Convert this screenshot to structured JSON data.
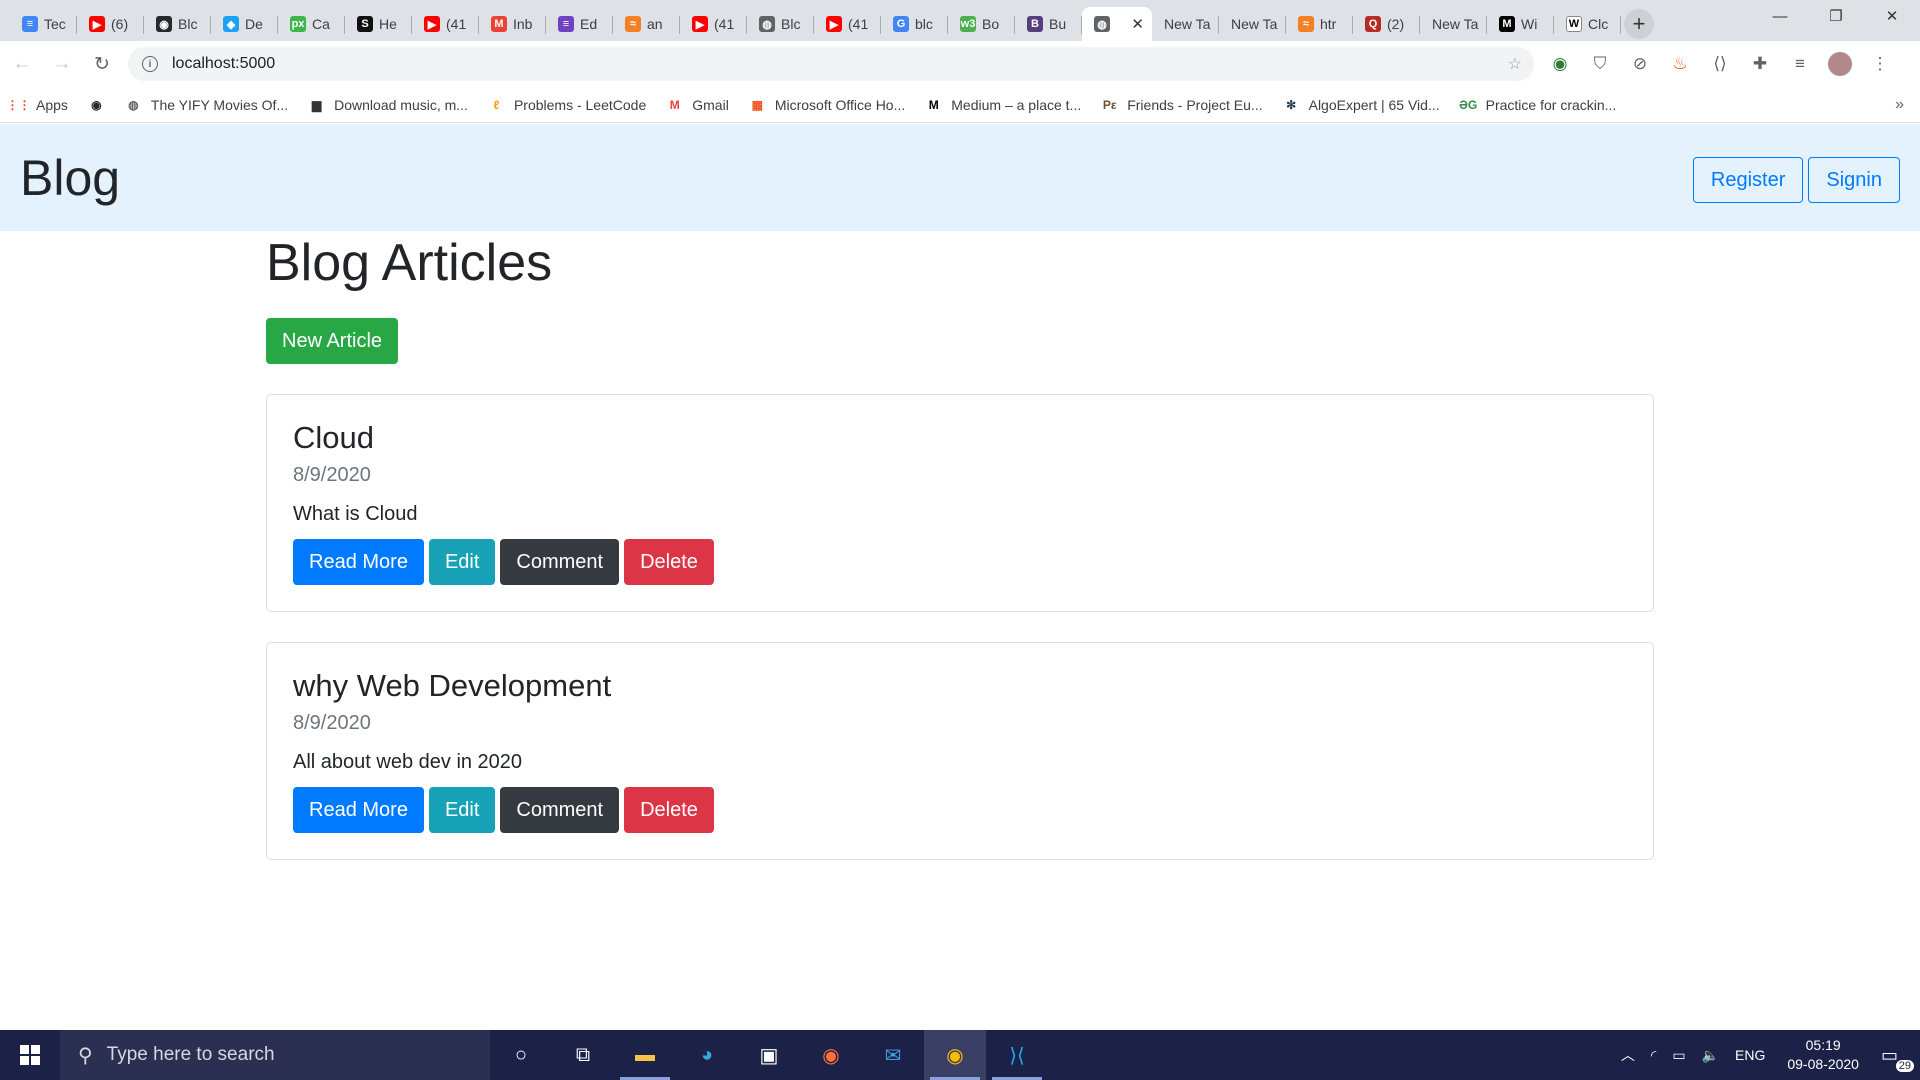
{
  "browser": {
    "tabs": [
      {
        "label": "Tec",
        "icon": "google-docs-icon",
        "color": "#4285f4",
        "glyph": "≡"
      },
      {
        "label": "(6)",
        "icon": "youtube-icon",
        "color": "#ff0000",
        "glyph": "▶"
      },
      {
        "label": "Blc",
        "icon": "github-icon",
        "color": "#24292e",
        "glyph": "◉"
      },
      {
        "label": "De",
        "icon": "bird-icon",
        "color": "#1da1f2",
        "glyph": "◆"
      },
      {
        "label": "Ca",
        "icon": "px-icon",
        "color": "#3cb54a",
        "glyph": "px"
      },
      {
        "label": "He",
        "icon": "s-logo-icon",
        "color": "#111111",
        "glyph": "S"
      },
      {
        "label": "(41",
        "icon": "youtube-icon",
        "color": "#ff0000",
        "glyph": "▶"
      },
      {
        "label": "Inb",
        "icon": "gmail-icon",
        "color": "#ea4335",
        "glyph": "M"
      },
      {
        "label": "Ed",
        "icon": "list-icon",
        "color": "#6f42c1",
        "glyph": "≡"
      },
      {
        "label": "an",
        "icon": "stackoverflow-icon",
        "color": "#f48024",
        "glyph": "≈"
      },
      {
        "label": "(41",
        "icon": "youtube-icon",
        "color": "#ff0000",
        "glyph": "▶"
      },
      {
        "label": "Blc",
        "icon": "globe-icon",
        "color": "#5f6368",
        "glyph": "◍"
      },
      {
        "label": "(41",
        "icon": "youtube-icon",
        "color": "#ff0000",
        "glyph": "▶"
      },
      {
        "label": "blc",
        "icon": "google-icon",
        "color": "#4285f4",
        "glyph": "G"
      },
      {
        "label": "Bo",
        "icon": "w3schools-icon",
        "color": "#4caf50",
        "glyph": "w3"
      },
      {
        "label": "Bu",
        "icon": "bootstrap-icon",
        "color": "#563d7c",
        "glyph": "B"
      },
      {
        "label": "",
        "icon": "globe-icon",
        "color": "#5f6368",
        "glyph": "◍",
        "active": true
      },
      {
        "label": "New Ta",
        "icon": "",
        "color": "",
        "glyph": ""
      },
      {
        "label": "New Ta",
        "icon": "",
        "color": "",
        "glyph": ""
      },
      {
        "label": "htr",
        "icon": "stackoverflow-icon",
        "color": "#f48024",
        "glyph": "≈"
      },
      {
        "label": "(2)",
        "icon": "quora-icon",
        "color": "#b92b27",
        "glyph": "Q"
      },
      {
        "label": "New Ta",
        "icon": "",
        "color": "",
        "glyph": ""
      },
      {
        "label": "Wi",
        "icon": "medium-icon",
        "color": "#000000",
        "glyph": "M"
      },
      {
        "label": "Clc",
        "icon": "wikipedia-icon",
        "color": "#ffffff",
        "glyph": "W"
      }
    ],
    "url": "localhost:5000",
    "bookmarks": [
      {
        "label": "Apps",
        "icon": "apps-grid-icon",
        "color": "#ea4335",
        "glyph": "⋮⋮"
      },
      {
        "label": "",
        "icon": "github-icon",
        "color": "#24292e",
        "glyph": "◉"
      },
      {
        "label": "The YIFY Movies Of...",
        "icon": "globe-icon",
        "color": "#5f6368",
        "glyph": "◍"
      },
      {
        "label": "Download music, m...",
        "icon": "car-icon",
        "color": "#333333",
        "glyph": "▆"
      },
      {
        "label": "Problems - LeetCode",
        "icon": "leetcode-icon",
        "color": "#f89f1b",
        "glyph": "ℓ"
      },
      {
        "label": "Gmail",
        "icon": "gmail-icon",
        "color": "#ea4335",
        "glyph": "M"
      },
      {
        "label": "Microsoft Office Ho...",
        "icon": "microsoft-icon",
        "color": "#f25022",
        "glyph": "▦"
      },
      {
        "label": "Medium – a place t...",
        "icon": "medium-icon",
        "color": "#000000",
        "glyph": "M"
      },
      {
        "label": "Friends - Project Eu...",
        "icon": "project-euler-icon",
        "color": "#6b4e2e",
        "glyph": "Pε"
      },
      {
        "label": "AlgoExpert | 65 Vid...",
        "icon": "algoexpert-icon",
        "color": "#2c3e50",
        "glyph": "✻"
      },
      {
        "label": "Practice for crackin...",
        "icon": "geeksforgeeks-icon",
        "color": "#2f8d46",
        "glyph": "ƏG"
      }
    ]
  },
  "app": {
    "brand": "Blog",
    "register_label": "Register",
    "signin_label": "Signin",
    "heading": "Blog Articles",
    "new_article_label": "New Article",
    "articles": [
      {
        "title": "Cloud",
        "date": "8/9/2020",
        "description": "What is Cloud"
      },
      {
        "title": "why Web Development",
        "date": "8/9/2020",
        "description": "All about web dev in 2020"
      }
    ],
    "buttons": {
      "read_more": "Read More",
      "edit": "Edit",
      "comment": "Comment",
      "delete": "Delete"
    },
    "colors": {
      "primary": "#007bff",
      "info": "#17a2b8",
      "dark": "#343a40",
      "danger": "#dc3545",
      "success": "#28a745",
      "navbar": "#e3f2fd"
    }
  },
  "taskbar": {
    "search_placeholder": "Type here to search",
    "language": "ENG",
    "time": "05:19",
    "date": "09-08-2020",
    "notification_count": "29"
  }
}
